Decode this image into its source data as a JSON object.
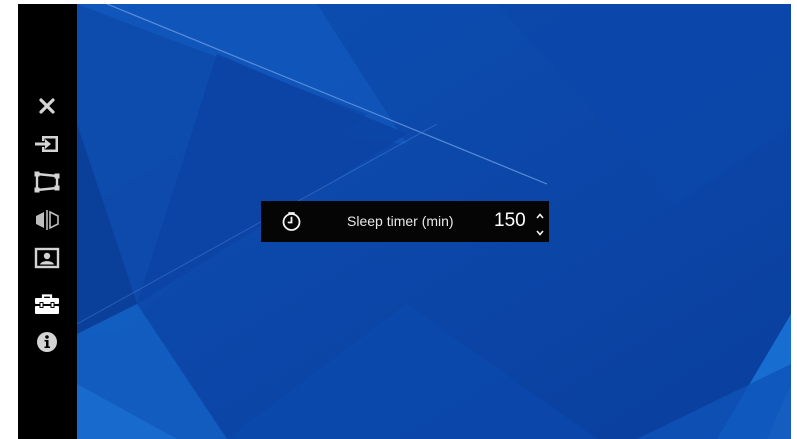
{
  "sidebar": {
    "items": [
      {
        "name": "close",
        "icon": "close-icon"
      },
      {
        "name": "input",
        "icon": "input-icon"
      },
      {
        "name": "keystone",
        "icon": "keystone-icon"
      },
      {
        "name": "flip",
        "icon": "flip-icon"
      },
      {
        "name": "picture",
        "icon": "picture-icon"
      },
      {
        "name": "tools",
        "icon": "toolbox-icon",
        "selected": true
      },
      {
        "name": "info",
        "icon": "info-icon"
      }
    ]
  },
  "osd": {
    "icon": "timer-icon",
    "label": "Sleep timer (min)",
    "value": "150"
  },
  "colors": {
    "desktop_blue": "#0a45a8",
    "sidebar": "#000000",
    "icon": "#d9d9d9"
  }
}
